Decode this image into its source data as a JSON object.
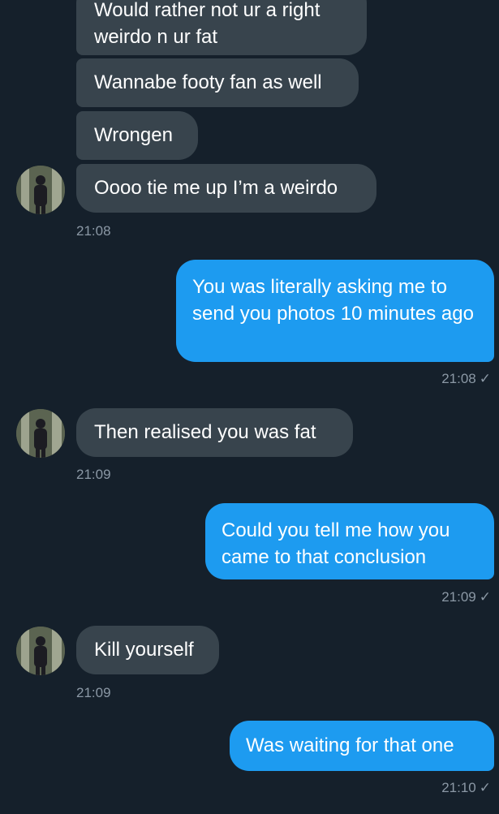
{
  "colors": {
    "background": "#15202b",
    "incoming_bubble": "#38444d",
    "outgoing_bubble": "#1d9bf0",
    "timestamp": "#8b98a5"
  },
  "messages": [
    {
      "direction": "in",
      "text": "Would rather not ur a right weirdo n ur fat"
    },
    {
      "direction": "in",
      "text": "Wannabe footy fan as well"
    },
    {
      "direction": "in",
      "text": "Wrongen"
    },
    {
      "direction": "in",
      "text": "Oooo tie me up I’m a weirdo"
    },
    {
      "direction": "out",
      "text": "You was literally asking me to send you photos 10 minutes ago"
    },
    {
      "direction": "in",
      "text": "Then realised you was fat"
    },
    {
      "direction": "out",
      "text": "Could you tell me how you came to that conclusion"
    },
    {
      "direction": "in",
      "text": "Kill yourself"
    },
    {
      "direction": "out",
      "text": "Was waiting for that one"
    }
  ],
  "timestamps": {
    "group1": "21:08",
    "reply1": "21:08",
    "group2": "21:09",
    "reply2": "21:09",
    "group3": "21:09",
    "reply3": "21:10"
  },
  "read_receipt_icon": "checkmark-icon",
  "read_receipt_glyph": "✓"
}
